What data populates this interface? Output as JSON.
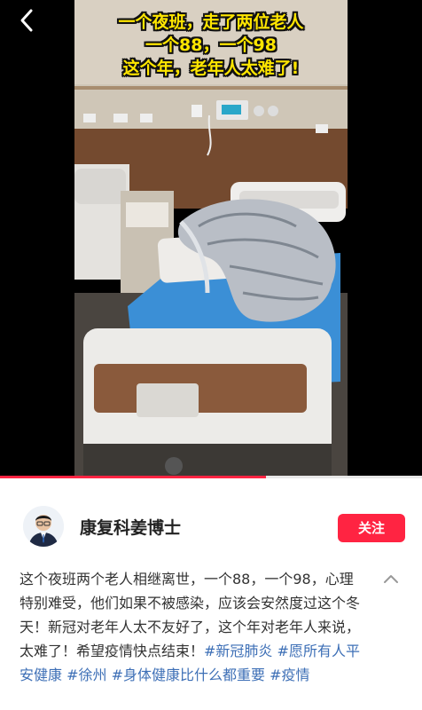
{
  "video": {
    "caption_lines": [
      "一个夜班，走了两位老人",
      "一个88，一个98",
      "这个年，老年人太难了!"
    ],
    "progress": 0.63
  },
  "nav": {
    "back_icon": "chevron-left-icon"
  },
  "author": {
    "name": "康复科姜博士",
    "follow_label": "关注"
  },
  "description": {
    "text": "这个夜班两个老人相继离世，一个88，一个98，心理特别难受，他们如果不被感染，应该会安然度过这个冬天！新冠对老年人太不友好了，这个年对老年人来说，太难了！希望疫情快点结束！",
    "hashtags": [
      "#新冠肺炎",
      "#愿所有人平安健康",
      "#徐州",
      "#身体健康比什么都重要",
      "#疫情"
    ]
  },
  "colors": {
    "accent": "#ff2442",
    "hashtag": "#3d6fb6",
    "caption": "#ffe600"
  }
}
